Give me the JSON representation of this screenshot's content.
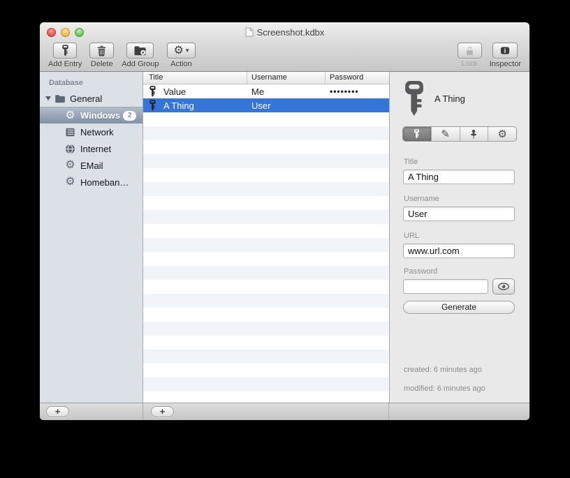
{
  "window": {
    "title": "Screenshot.kdbx"
  },
  "toolbar": {
    "items": [
      {
        "label": "Add Entry",
        "icon": "key-icon",
        "enabled": true
      },
      {
        "label": "Delete",
        "icon": "trash-icon",
        "enabled": true
      },
      {
        "label": "Add Group",
        "icon": "folder-plus-icon",
        "enabled": true
      },
      {
        "label": "Action",
        "icon": "gear-icon",
        "has_dropdown": true,
        "enabled": true
      },
      {
        "label": "Lock",
        "icon": "lock-open-icon",
        "enabled": false
      },
      {
        "label": "Inspector",
        "icon": "info-icon",
        "enabled": true
      }
    ],
    "gear_glyph": "⚙",
    "drop_arrow": "▾"
  },
  "sidebar": {
    "header": "Database",
    "items": [
      {
        "label": "General",
        "icon": "folder-icon",
        "expanded": true,
        "level": 0,
        "selected": false
      },
      {
        "label": "Windows",
        "icon": "gear-icon",
        "badge": "2",
        "level": 1,
        "selected": true
      },
      {
        "label": "Network",
        "icon": "server-icon",
        "level": 1,
        "selected": false
      },
      {
        "label": "Internet",
        "icon": "globe-icon",
        "level": 1,
        "selected": false
      },
      {
        "label": "EMail",
        "icon": "gear-icon",
        "level": 1,
        "selected": false
      },
      {
        "label": "Homeban…",
        "icon": "gear-icon",
        "level": 1,
        "selected": false
      }
    ],
    "add_button": "+"
  },
  "entry_table": {
    "columns": [
      "Title",
      "Username",
      "Password"
    ],
    "rows": [
      {
        "title": "Value",
        "username": "Me",
        "password_display": "••••••••",
        "selected": false
      },
      {
        "title": "A Thing",
        "username": "User",
        "password_display": "",
        "selected": true
      }
    ],
    "filler_row_count": 21,
    "add_button": "+"
  },
  "inspector": {
    "entry_title": "A Thing",
    "tabs": [
      "key-tab",
      "pencil-tab",
      "pin-tab",
      "gear-tab"
    ],
    "selected_tab_index": 0,
    "glyphs": {
      "gear": "⚙",
      "pencil": "✎"
    },
    "fields": [
      {
        "label": "Title",
        "value": "A Thing"
      },
      {
        "label": "Username",
        "value": "User"
      },
      {
        "label": "URL",
        "value": "www.url.com"
      },
      {
        "label": "Password",
        "value": "",
        "has_reveal": true
      }
    ],
    "generate_label": "Generate",
    "created": "created: 6 minutes ago",
    "modified": "modified: 6 minutes ago"
  },
  "colors": {
    "selection_blue": "#3574d8",
    "sidebar_selection_top": "#b2bcca",
    "sidebar_selection_bottom": "#8191a7",
    "row_stripe": "#f1f4f9",
    "sidebar_bg": "#dce1e8",
    "inspector_bg": "#e9e9e9"
  }
}
